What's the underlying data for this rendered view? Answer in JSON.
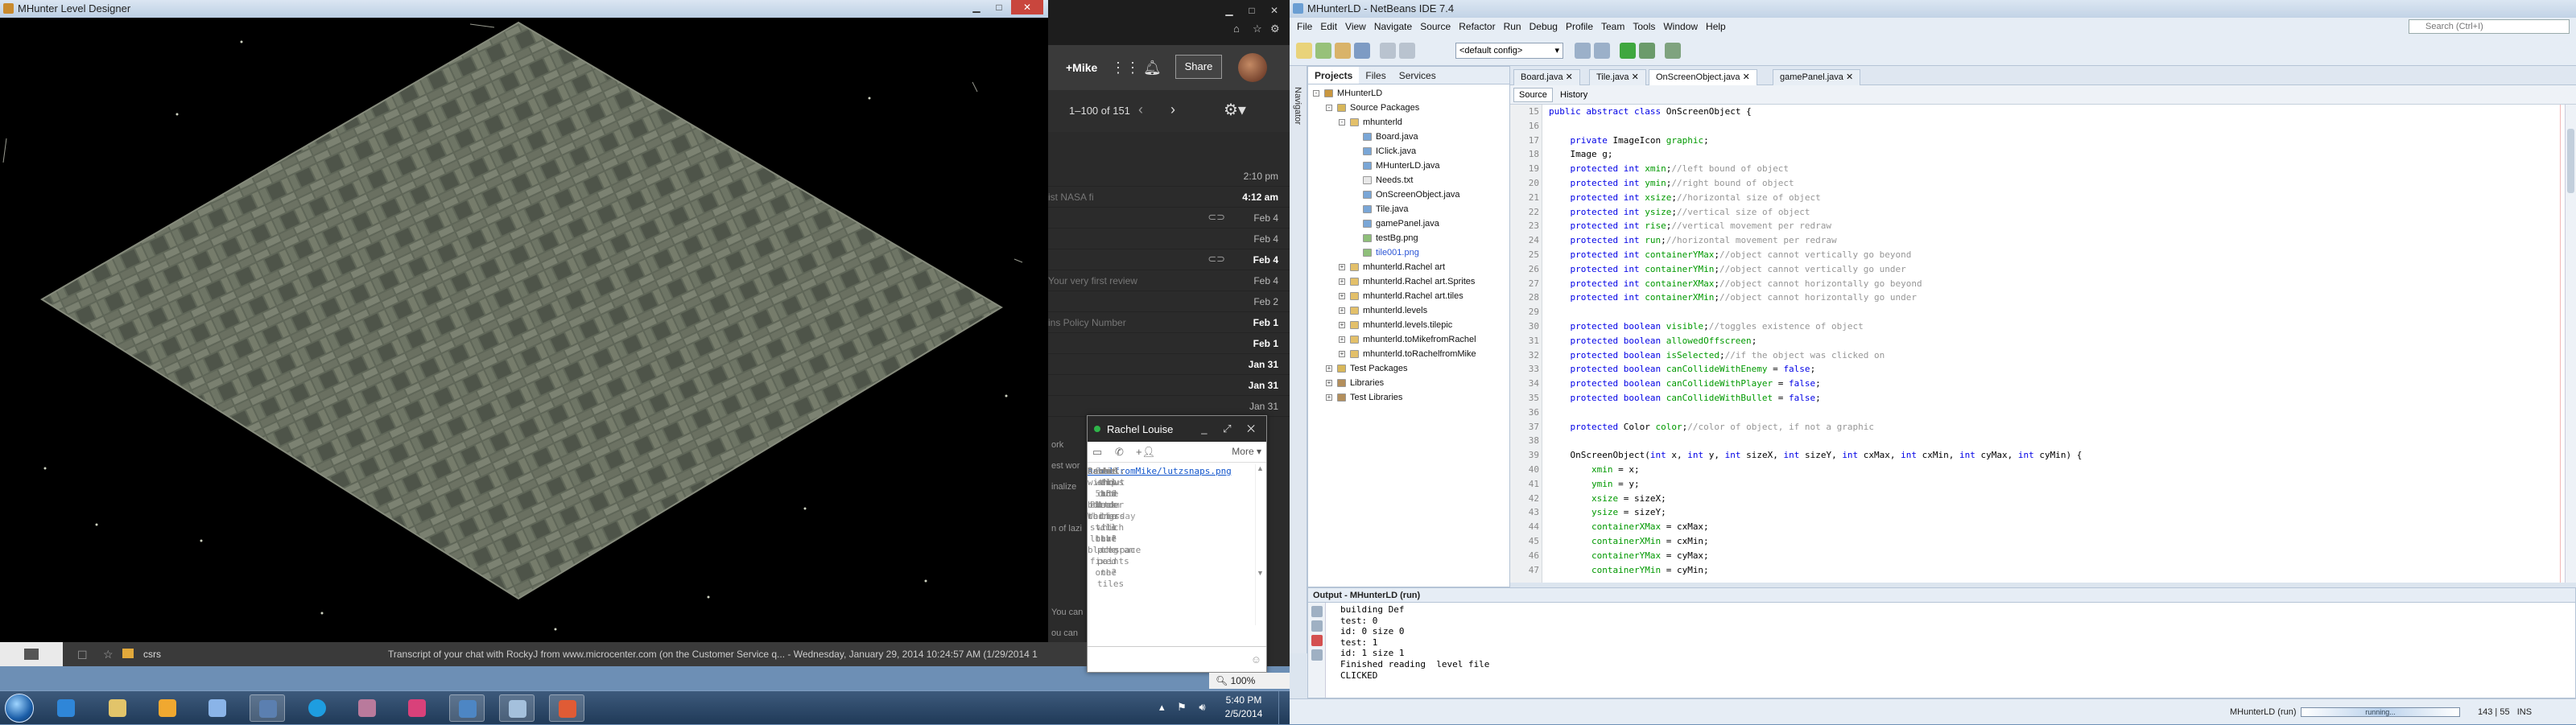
{
  "level_window": {
    "title": "MHunter Level Designer"
  },
  "browser": {
    "plus_user": "+Mike",
    "share_label": "Share",
    "page_count": "1–100 of 151",
    "rows": [
      {
        "subject": "",
        "date": "2:10 pm",
        "bold": false,
        "clip": false
      },
      {
        "subject": "ist NASA fi",
        "date": "4:12 am",
        "bold": true,
        "clip": false
      },
      {
        "subject": "",
        "date": "Feb 4",
        "bold": false,
        "clip": true
      },
      {
        "subject": "",
        "date": "Feb 4",
        "bold": false,
        "clip": false
      },
      {
        "subject": "",
        "date": "Feb 4",
        "bold": true,
        "clip": true
      },
      {
        "subject": "Your very first review",
        "date": "Feb 4",
        "bold": false,
        "clip": false
      },
      {
        "subject": "",
        "date": "Feb 2",
        "bold": false,
        "clip": false
      },
      {
        "subject": "ins Policy Number",
        "date": "Feb 1",
        "bold": true,
        "clip": false
      },
      {
        "subject": "",
        "date": "Feb 1",
        "bold": true,
        "clip": false
      },
      {
        "subject": "",
        "date": "Jan 31",
        "bold": true,
        "clip": false
      },
      {
        "subject": "",
        "date": "Jan 31",
        "bold": true,
        "clip": false
      },
      {
        "subject": "",
        "date": "Jan 31",
        "bold": false,
        "clip": false
      }
    ],
    "left_fragments": [
      "ork",
      "est wor",
      "inalize",
      "",
      "n of lazi",
      "",
      "",
      "",
      "You can",
      "ou can"
    ],
    "zoom": "100%"
  },
  "chat": {
    "name": "Rachel Louise",
    "more": "More ▾",
    "link": "achelfromMike/lutzsnaps.png",
    "lines": [
      {
        "who": "",
        "text": "this is cute",
        "cls": "ind"
      },
      {
        "who": "",
        "text": "it shows the order in which the program paints the tiles",
        "cls": "ind"
      },
      {
        "who": "Rachel:",
        "text": "well how does the tile look?",
        "cls": ""
      },
      {
        "who": "",
        "text": "Sent at 5:30 PM on Wednesday",
        "cls": "meta"
      },
      {
        "who": "Rachel:",
        "text": "without the black things is that the fixed one?",
        "cls": ""
      },
      {
        "who": "me:",
        "text": "top and bottom corners still have blackspace",
        "cls": ""
      }
    ]
  },
  "strip": {
    "folder": "csrs",
    "transcript": "Transcript of your chat with RockyJ from www.microcenter.com (on the Customer Service q... - Wednesday, January 29, 2014 10:24:57 AM (1/29/2014 1"
  },
  "netbeans": {
    "title": "MHunterLD - NetBeans IDE 7.4",
    "menu": [
      "File",
      "Edit",
      "View",
      "Navigate",
      "Source",
      "Refactor",
      "Run",
      "Debug",
      "Profile",
      "Team",
      "Tools",
      "Window",
      "Help"
    ],
    "search_placeholder": "Search (Ctrl+I)",
    "config": "<default config>",
    "navigator_label": "Navigator",
    "panel_tabs": [
      "Projects",
      "Files",
      "Services"
    ],
    "tree": [
      {
        "label": "MHunterLD",
        "indent": 0,
        "toggle": "-",
        "icon": "project",
        "sel": false
      },
      {
        "label": "Source Packages",
        "indent": 1,
        "toggle": "-",
        "icon": "srcfolder",
        "sel": false
      },
      {
        "label": "mhunterld",
        "indent": 2,
        "toggle": "-",
        "icon": "package",
        "sel": false
      },
      {
        "label": "Board.java",
        "indent": 3,
        "toggle": "",
        "icon": "java",
        "sel": false
      },
      {
        "label": "IClick.java",
        "indent": 3,
        "toggle": "",
        "icon": "java",
        "sel": false
      },
      {
        "label": "MHunterLD.java",
        "indent": 3,
        "toggle": "",
        "icon": "java",
        "sel": false
      },
      {
        "label": "Needs.txt",
        "indent": 3,
        "toggle": "",
        "icon": "file",
        "sel": false
      },
      {
        "label": "OnScreenObject.java",
        "indent": 3,
        "toggle": "",
        "icon": "java",
        "sel": false
      },
      {
        "label": "Tile.java",
        "indent": 3,
        "toggle": "",
        "icon": "java",
        "sel": false
      },
      {
        "label": "gamePanel.java",
        "indent": 3,
        "toggle": "",
        "icon": "java",
        "sel": false
      },
      {
        "label": "testBg.png",
        "indent": 3,
        "toggle": "",
        "icon": "image",
        "sel": false
      },
      {
        "label": "tile001.png",
        "indent": 3,
        "toggle": "",
        "icon": "image",
        "sel": true
      },
      {
        "label": "mhunterld.Rachel art",
        "indent": 2,
        "toggle": "+",
        "icon": "package",
        "sel": false
      },
      {
        "label": "mhunterld.Rachel art.Sprites",
        "indent": 2,
        "toggle": "+",
        "icon": "package",
        "sel": false
      },
      {
        "label": "mhunterld.Rachel art.tiles",
        "indent": 2,
        "toggle": "+",
        "icon": "package",
        "sel": false
      },
      {
        "label": "mhunterld.levels",
        "indent": 2,
        "toggle": "+",
        "icon": "package",
        "sel": false
      },
      {
        "label": "mhunterld.levels.tilepic",
        "indent": 2,
        "toggle": "+",
        "icon": "package",
        "sel": false
      },
      {
        "label": "mhunterld.toMikefromRachel",
        "indent": 2,
        "toggle": "+",
        "icon": "package",
        "sel": false
      },
      {
        "label": "mhunterld.toRachelfromMike",
        "indent": 2,
        "toggle": "+",
        "icon": "package",
        "sel": false
      },
      {
        "label": "Test Packages",
        "indent": 1,
        "toggle": "+",
        "icon": "srcfolder",
        "sel": false
      },
      {
        "label": "Libraries",
        "indent": 1,
        "toggle": "+",
        "icon": "lib",
        "sel": false
      },
      {
        "label": "Test Libraries",
        "indent": 1,
        "toggle": "+",
        "icon": "lib",
        "sel": false
      }
    ],
    "editor_tabs": [
      {
        "label": "Board.java",
        "active": false
      },
      {
        "label": "Tile.java",
        "active": false
      },
      {
        "label": "OnScreenObject.java",
        "active": true
      },
      {
        "label": "gamePanel.java",
        "active": false
      }
    ],
    "view_source": "Source",
    "view_history": "History",
    "code": [
      {
        "n": "15",
        "t": "public abstract class OnScreenObject {"
      },
      {
        "n": "16",
        "t": ""
      },
      {
        "n": "17",
        "t": "    private ImageIcon graphic;"
      },
      {
        "n": "18",
        "t": "    Image g;"
      },
      {
        "n": "19",
        "t": "    protected int xmin;//left bound of object"
      },
      {
        "n": "20",
        "t": "    protected int ymin;//right bound of object"
      },
      {
        "n": "21",
        "t": "    protected int xsize;//horizontal size of object"
      },
      {
        "n": "22",
        "t": "    protected int ysize;//vertical size of object"
      },
      {
        "n": "23",
        "t": "    protected int rise;//vertical movement per redraw"
      },
      {
        "n": "24",
        "t": "    protected int run;//horizontal movement per redraw"
      },
      {
        "n": "25",
        "t": "    protected int containerYMax;//object cannot vertically go beyond"
      },
      {
        "n": "26",
        "t": "    protected int containerYMin;//object cannot vertically go under"
      },
      {
        "n": "27",
        "t": "    protected int containerXMax;//object cannot horizontally go beyond"
      },
      {
        "n": "28",
        "t": "    protected int containerXMin;//object cannot horizontally go under"
      },
      {
        "n": "29",
        "t": ""
      },
      {
        "n": "30",
        "t": "    protected boolean visible;//toggles existence of object"
      },
      {
        "n": "31",
        "t": "    protected boolean allowedOffscreen;"
      },
      {
        "n": "32",
        "t": "    protected boolean isSelected;//if the object was clicked on"
      },
      {
        "n": "33",
        "t": "    protected boolean canCollideWithEnemy = false;"
      },
      {
        "n": "34",
        "t": "    protected boolean canCollideWithPlayer = false;"
      },
      {
        "n": "35",
        "t": "    protected boolean canCollideWithBullet = false;"
      },
      {
        "n": "36",
        "t": ""
      },
      {
        "n": "37",
        "t": "    protected Color color;//color of object, if not a graphic"
      },
      {
        "n": "38",
        "t": ""
      },
      {
        "n": "39",
        "t": "    OnScreenObject(int x, int y, int sizeX, int sizeY, int cxMax, int cxMin, int cyMax, int cyMin) {"
      },
      {
        "n": "40",
        "t": "        xmin = x;"
      },
      {
        "n": "41",
        "t": "        ymin = y;"
      },
      {
        "n": "42",
        "t": "        xsize = sizeX;"
      },
      {
        "n": "43",
        "t": "        ysize = sizeY;"
      },
      {
        "n": "44",
        "t": "        containerXMax = cxMax;"
      },
      {
        "n": "45",
        "t": "        containerXMin = cxMin;"
      },
      {
        "n": "46",
        "t": "        containerYMax = cyMax;"
      },
      {
        "n": "47",
        "t": "        containerYMin = cyMin;"
      }
    ],
    "output_title": "Output - MHunterLD (run)",
    "output_lines": [
      "building Def",
      "test: 0",
      "id: 0 size 0",
      "test: 1",
      "id: 1 size 1",
      "Finished reading  level file",
      "CLICKED"
    ],
    "status_run": "MHunterLD (run)",
    "status_bar": "running...",
    "status_pos": "143 | 55",
    "status_mode": "INS"
  },
  "taskbar": {
    "time": "5:40 PM",
    "date": "2/5/2014"
  }
}
